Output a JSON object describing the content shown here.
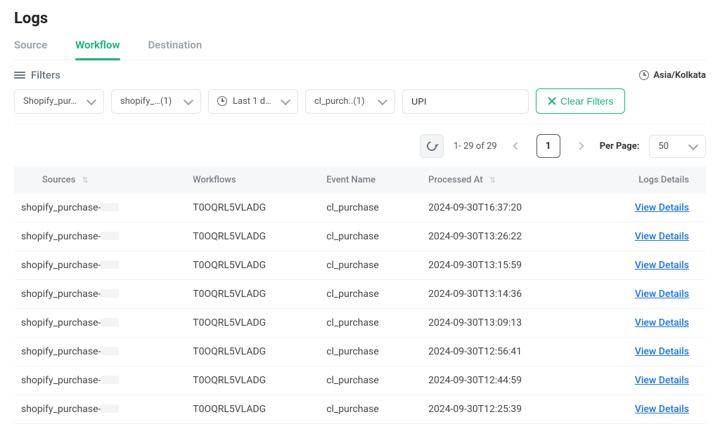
{
  "page_title": "Logs",
  "tabs": [
    {
      "label": "Source",
      "active": false
    },
    {
      "label": "Workflow",
      "active": true
    },
    {
      "label": "Destination",
      "active": false
    }
  ],
  "filters": {
    "label": "Filters",
    "timezone": "Asia/Kolkata",
    "source_dd": "Shopify_pur…",
    "workflow_dd": "shopify_…(1)",
    "date_dd": "Last 1 d…",
    "event_dd": "cl_purch..(1)",
    "search_value": "UPI",
    "clear_label": "Clear Filters"
  },
  "pager": {
    "range_text": "1- 29 of 29",
    "current_page": "1",
    "per_page_label": "Per Page:",
    "per_page_value": "50"
  },
  "columns": {
    "sources": "Sources",
    "workflows": "Workflows",
    "event": "Event Name",
    "processed": "Processed At",
    "details": "Logs Details"
  },
  "link_label": "View Details",
  "source_prefix": "shopify_purchase-",
  "workflow_id": "T0OQRL5VLADG",
  "event_name": "cl_purchase",
  "rows": [
    {
      "processed": "2024-09-30T16:37:20"
    },
    {
      "processed": "2024-09-30T13:26:22"
    },
    {
      "processed": "2024-09-30T13:15:59"
    },
    {
      "processed": "2024-09-30T13:14:36"
    },
    {
      "processed": "2024-09-30T13:09:13"
    },
    {
      "processed": "2024-09-30T12:56:41"
    },
    {
      "processed": "2024-09-30T12:44:59"
    },
    {
      "processed": "2024-09-30T12:25:39"
    }
  ]
}
